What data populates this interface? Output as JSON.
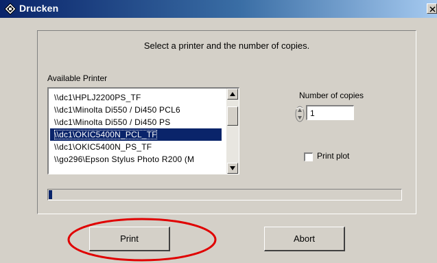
{
  "window": {
    "title": "Drucken",
    "icon": "printer-app-icon",
    "close_icon": "close-icon"
  },
  "dialog": {
    "instruction": "Select a printer and the number of copies.",
    "printer_list": {
      "label": "Available Printer",
      "items": [
        "\\\\dc1\\HPLJ2200PS_TF",
        "\\\\dc1\\Minolta Di550 / Di450 PCL6",
        "\\\\dc1\\Minolta Di550 / Di450 PS",
        "\\\\dc1\\OKIC5400N_PCL_TF",
        "\\\\dc1\\OKIC5400N_PS_TF",
        "\\\\go296\\Epson Stylus Photo R200 (M"
      ],
      "selected_index": 3
    },
    "copies": {
      "label": "Number of copies",
      "value": "1"
    },
    "print_plot": {
      "label": "Print plot",
      "checked": false
    },
    "progress": 0.01
  },
  "buttons": {
    "print": "Print",
    "abort": "Abort"
  },
  "colors": {
    "selection": "#0a246a",
    "face": "#d4d0c8",
    "highlight_annotation": "#e00000"
  }
}
